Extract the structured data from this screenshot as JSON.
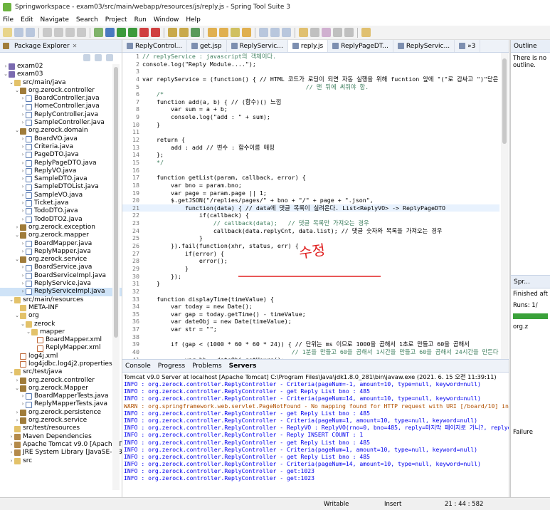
{
  "window": {
    "title": "Springworkspace - exam03/src/main/webapp/resources/js/reply.js - Spring Tool Suite 3"
  },
  "menu": [
    "File",
    "Edit",
    "Navigate",
    "Search",
    "Project",
    "Run",
    "Window",
    "Help"
  ],
  "package_explorer": {
    "tab_label": "Package Explorer",
    "tree": [
      {
        "indent": 0,
        "arrow": ">",
        "icon": "proj",
        "label": "exam02"
      },
      {
        "indent": 0,
        "arrow": "v",
        "icon": "proj",
        "label": "exam03"
      },
      {
        "indent": 1,
        "arrow": "v",
        "icon": "folder",
        "label": "src/main/java"
      },
      {
        "indent": 2,
        "arrow": "v",
        "icon": "pkg",
        "label": "org.zerock.controller"
      },
      {
        "indent": 3,
        "arrow": ">",
        "icon": "java",
        "label": "BoardController.java"
      },
      {
        "indent": 3,
        "arrow": ">",
        "icon": "java",
        "label": "HomeController.java"
      },
      {
        "indent": 3,
        "arrow": ">",
        "icon": "java",
        "label": "ReplyController.java"
      },
      {
        "indent": 3,
        "arrow": ">",
        "icon": "java",
        "label": "SampleController.java"
      },
      {
        "indent": 2,
        "arrow": "v",
        "icon": "pkg",
        "label": "org.zerock.domain"
      },
      {
        "indent": 3,
        "arrow": ">",
        "icon": "java",
        "label": "BoardVO.java"
      },
      {
        "indent": 3,
        "arrow": ">",
        "icon": "java",
        "label": "Criteria.java"
      },
      {
        "indent": 3,
        "arrow": ">",
        "icon": "java",
        "label": "PageDTO.java"
      },
      {
        "indent": 3,
        "arrow": ">",
        "icon": "java",
        "label": "ReplyPageDTO.java"
      },
      {
        "indent": 3,
        "arrow": ">",
        "icon": "java",
        "label": "ReplyVO.java"
      },
      {
        "indent": 3,
        "arrow": ">",
        "icon": "java",
        "label": "SampleDTO.java"
      },
      {
        "indent": 3,
        "arrow": ">",
        "icon": "java",
        "label": "SampleDTOList.java"
      },
      {
        "indent": 3,
        "arrow": ">",
        "icon": "java",
        "label": "SampleVO.java"
      },
      {
        "indent": 3,
        "arrow": ">",
        "icon": "java",
        "label": "Ticket.java"
      },
      {
        "indent": 3,
        "arrow": ">",
        "icon": "java",
        "label": "TodoDTO.java"
      },
      {
        "indent": 3,
        "arrow": ">",
        "icon": "java",
        "label": "TodoDTO2.java"
      },
      {
        "indent": 2,
        "arrow": ">",
        "icon": "pkg",
        "label": "org.zerock.exception"
      },
      {
        "indent": 2,
        "arrow": "v",
        "icon": "pkg",
        "label": "org.zerock.mapper"
      },
      {
        "indent": 3,
        "arrow": ">",
        "icon": "java",
        "label": "BoardMapper.java"
      },
      {
        "indent": 3,
        "arrow": ">",
        "icon": "java",
        "label": "ReplyMapper.java"
      },
      {
        "indent": 2,
        "arrow": "v",
        "icon": "pkg",
        "label": "org.zerock.service"
      },
      {
        "indent": 3,
        "arrow": ">",
        "icon": "java",
        "label": "BoardService.java"
      },
      {
        "indent": 3,
        "arrow": ">",
        "icon": "java",
        "label": "BoardServiceImpl.java"
      },
      {
        "indent": 3,
        "arrow": ">",
        "icon": "java",
        "label": "ReplyService.java"
      },
      {
        "indent": 3,
        "arrow": ">",
        "icon": "java",
        "label": "ReplyServiceImpl.java",
        "selected": true
      },
      {
        "indent": 1,
        "arrow": "v",
        "icon": "folder",
        "label": "src/main/resources"
      },
      {
        "indent": 2,
        "arrow": "",
        "icon": "folder",
        "label": "META-INF"
      },
      {
        "indent": 2,
        "arrow": "v",
        "icon": "folder",
        "label": "org"
      },
      {
        "indent": 3,
        "arrow": "v",
        "icon": "folder",
        "label": "zerock"
      },
      {
        "indent": 4,
        "arrow": "v",
        "icon": "folder",
        "label": "mapper"
      },
      {
        "indent": 5,
        "arrow": "",
        "icon": "xml",
        "label": "BoardMapper.xml"
      },
      {
        "indent": 5,
        "arrow": "",
        "icon": "xml",
        "label": "ReplyMapper.xml"
      },
      {
        "indent": 2,
        "arrow": "",
        "icon": "xml",
        "label": "log4j.xml"
      },
      {
        "indent": 2,
        "arrow": "",
        "icon": "xml",
        "label": "log4jdbc.log4j2.properties"
      },
      {
        "indent": 1,
        "arrow": "v",
        "icon": "folder",
        "label": "src/test/java"
      },
      {
        "indent": 2,
        "arrow": ">",
        "icon": "pkg",
        "label": "org.zerock.controller"
      },
      {
        "indent": 2,
        "arrow": "v",
        "icon": "pkg",
        "label": "org.zerock.Mapper"
      },
      {
        "indent": 3,
        "arrow": ">",
        "icon": "java",
        "label": "BoardMapperTests.java"
      },
      {
        "indent": 3,
        "arrow": ">",
        "icon": "java",
        "label": "ReplyMapperTests.java"
      },
      {
        "indent": 2,
        "arrow": ">",
        "icon": "pkg",
        "label": "org.zerock.persistence"
      },
      {
        "indent": 2,
        "arrow": ">",
        "icon": "pkg",
        "label": "org.zerock.service"
      },
      {
        "indent": 1,
        "arrow": "",
        "icon": "folder",
        "label": "src/test/resources"
      },
      {
        "indent": 1,
        "arrow": ">",
        "icon": "lib",
        "label": "Maven Dependencies"
      },
      {
        "indent": 1,
        "arrow": ">",
        "icon": "lib",
        "label": "Apache Tomcat v9.0 [Apache T"
      },
      {
        "indent": 1,
        "arrow": ">",
        "icon": "lib",
        "label": "JRE System Library [JavaSE-1.8"
      },
      {
        "indent": 1,
        "arrow": ">",
        "icon": "folder",
        "label": "src"
      }
    ]
  },
  "editor": {
    "tabs": [
      {
        "label": "ReplyControl..."
      },
      {
        "label": "get.jsp"
      },
      {
        "label": "ReplyServic..."
      },
      {
        "label": "reply.js",
        "active": true
      },
      {
        "label": "ReplyPageDT..."
      },
      {
        "label": "ReplyServic..."
      },
      {
        "label": "»3"
      }
    ],
    "lines": [
      {
        "n": "1",
        "t": "// replyService : javascript의 객체이다."
      },
      {
        "n": "2",
        "t": "console.log(\"Reply Module....\");"
      },
      {
        "n": "3",
        "t": ""
      },
      {
        "n": "4",
        "t": "var replyService = (function() { // HTML 코드가 로딩이 되면 자동 실행을 위해 fucntion 앞에 \"(\"로 감싸고 \")\"닫은 뒤 ();를"
      },
      {
        "n": "5",
        "t": "                                              // 맨 뒤에 써줘야 함."
      },
      {
        "n": "6",
        "t": "    /*"
      },
      {
        "n": "7",
        "t": "    function add(a, b) { // (함수)() 느낌"
      },
      {
        "n": "8",
        "t": "        var sum = a + b;"
      },
      {
        "n": "9",
        "t": "        console.log(\"add : \" + sum);"
      },
      {
        "n": "10",
        "t": "    }"
      },
      {
        "n": "11",
        "t": ""
      },
      {
        "n": "12",
        "t": "    return {"
      },
      {
        "n": "13",
        "t": "        add : add // 변수 : 함수이름 매핑"
      },
      {
        "n": "14",
        "t": "    };"
      },
      {
        "n": "15",
        "t": "    */"
      },
      {
        "n": "16",
        "t": ""
      },
      {
        "n": "17",
        "t": "    function getList(param, callback, error) {"
      },
      {
        "n": "18",
        "t": "        var bno = param.bno;"
      },
      {
        "n": "19",
        "t": "        var page = param.page || 1;"
      },
      {
        "n": "20",
        "t": "        $.getJSON(\"/replies/pages/\" + bno + \"/\" + page + \".json\","
      },
      {
        "n": "21",
        "t": "            function(data) { // data에 댓글 목록이 실려온다. List<ReplyVO> -> ReplyPageDTO",
        "hl": true
      },
      {
        "n": "22",
        "t": "                if(callback) {"
      },
      {
        "n": "23",
        "t": "                    // callback(data);   // 댓글 목록만 가져오는 경우"
      },
      {
        "n": "24",
        "t": "                    callback(data.replyCnt, data.list); // 댓글 숫자와 목록을 가져오는 경우"
      },
      {
        "n": "25",
        "t": "                }"
      },
      {
        "n": "26",
        "t": "        }).fail(function(xhr, status, err) {"
      },
      {
        "n": "27",
        "t": "            if(error) {"
      },
      {
        "n": "28",
        "t": "                error();"
      },
      {
        "n": "29",
        "t": "            }"
      },
      {
        "n": "30",
        "t": "        });"
      },
      {
        "n": "31",
        "t": "    }"
      },
      {
        "n": "32",
        "t": ""
      },
      {
        "n": "33",
        "t": "    function displayTime(timeValue) {"
      },
      {
        "n": "34",
        "t": "        var today = new Date();"
      },
      {
        "n": "35",
        "t": "        var gap = today.getTime() - timeValue;"
      },
      {
        "n": "36",
        "t": "        var dateObj = new Date(timeValue);"
      },
      {
        "n": "37",
        "t": "        var str = \"\";"
      },
      {
        "n": "38",
        "t": ""
      },
      {
        "n": "39",
        "t": "        if (gap < (1000 * 60 * 60 * 24)) { // 단위는 ms 이므로 1000을 곱해서 1초로 만들고 60을 곱해서"
      },
      {
        "n": "40",
        "t": "                                          // 1분을 만들고 60을 곱해서 1시간을 만들고 60을 곱해서 24시간을 만든다."
      },
      {
        "n": "41",
        "t": "            var hh = dateObj.getHours();"
      }
    ],
    "handwritten_note": "수정"
  },
  "console": {
    "tabs": [
      "Console",
      "Progress",
      "Problems",
      "Servers"
    ],
    "header": "Tomcat v9.0 Server at localhost [Apache Tomcat] C:\\Program Files\\Java\\jdk1.8.0_281\\bin\\javaw.exe  (2021. 6. 15 오전 11:39:11)",
    "lines": [
      {
        "t": "INFO : org.zerock.controller.ReplyController - Criteria(pageNum=-1, amount=10, type=null, keyword=null)"
      },
      {
        "t": "INFO : org.zerock.controller.ReplyController - get Reply List bno : 485"
      },
      {
        "t": "INFO : org.zerock.controller.ReplyController - Criteria(pageNum=14, amount=10, type=null, keyword=null)"
      },
      {
        "t": "WARN : org.springframework.web.servlet.PageNotFound - No mapping found for HTTP request with URI [/board/10] in Di",
        "warn": true
      },
      {
        "t": "INFO : org.zerock.controller.ReplyController - get Reply List bno : 485"
      },
      {
        "t": "INFO : org.zerock.controller.ReplyController - Criteria(pageNum=1, amount=10, type=null, keyword=null)"
      },
      {
        "t": "INFO : org.zerock.controller.ReplyController - ReplyVO : ReplyVO(rno=0, bno=485, reply=마지막 페이지로 가니?, replyer=La"
      },
      {
        "t": "INFO : org.zerock.controller.ReplyController - Reply INSERT COUNT : 1"
      },
      {
        "t": "INFO : org.zerock.controller.ReplyController - get Reply List bno : 485"
      },
      {
        "t": "INFO : org.zerock.controller.ReplyController - Criteria(pageNum=1, amount=10, type=null, keyword=null)"
      },
      {
        "t": "INFO : org.zerock.controller.ReplyController - get Reply List bno : 485"
      },
      {
        "t": "INFO : org.zerock.controller.ReplyController - Criteria(pageNum=14, amount=10, type=null, keyword=null)"
      },
      {
        "t": "INFO : org.zerock.controller.ReplyController - get:1023"
      },
      {
        "t": "INFO : org.zerock.controller.ReplyController - get:1023"
      }
    ]
  },
  "outline": {
    "tab_label": "Outline",
    "message": "There is no outline."
  },
  "junit": {
    "tab_label": "Spr...",
    "finished": "Finished aft",
    "runs": "Runs: 1/",
    "tree_item": "org.z",
    "failure": "Failure"
  },
  "statusbar": {
    "writable": "Writable",
    "insert": "Insert",
    "position": "21 : 44 : 582"
  }
}
